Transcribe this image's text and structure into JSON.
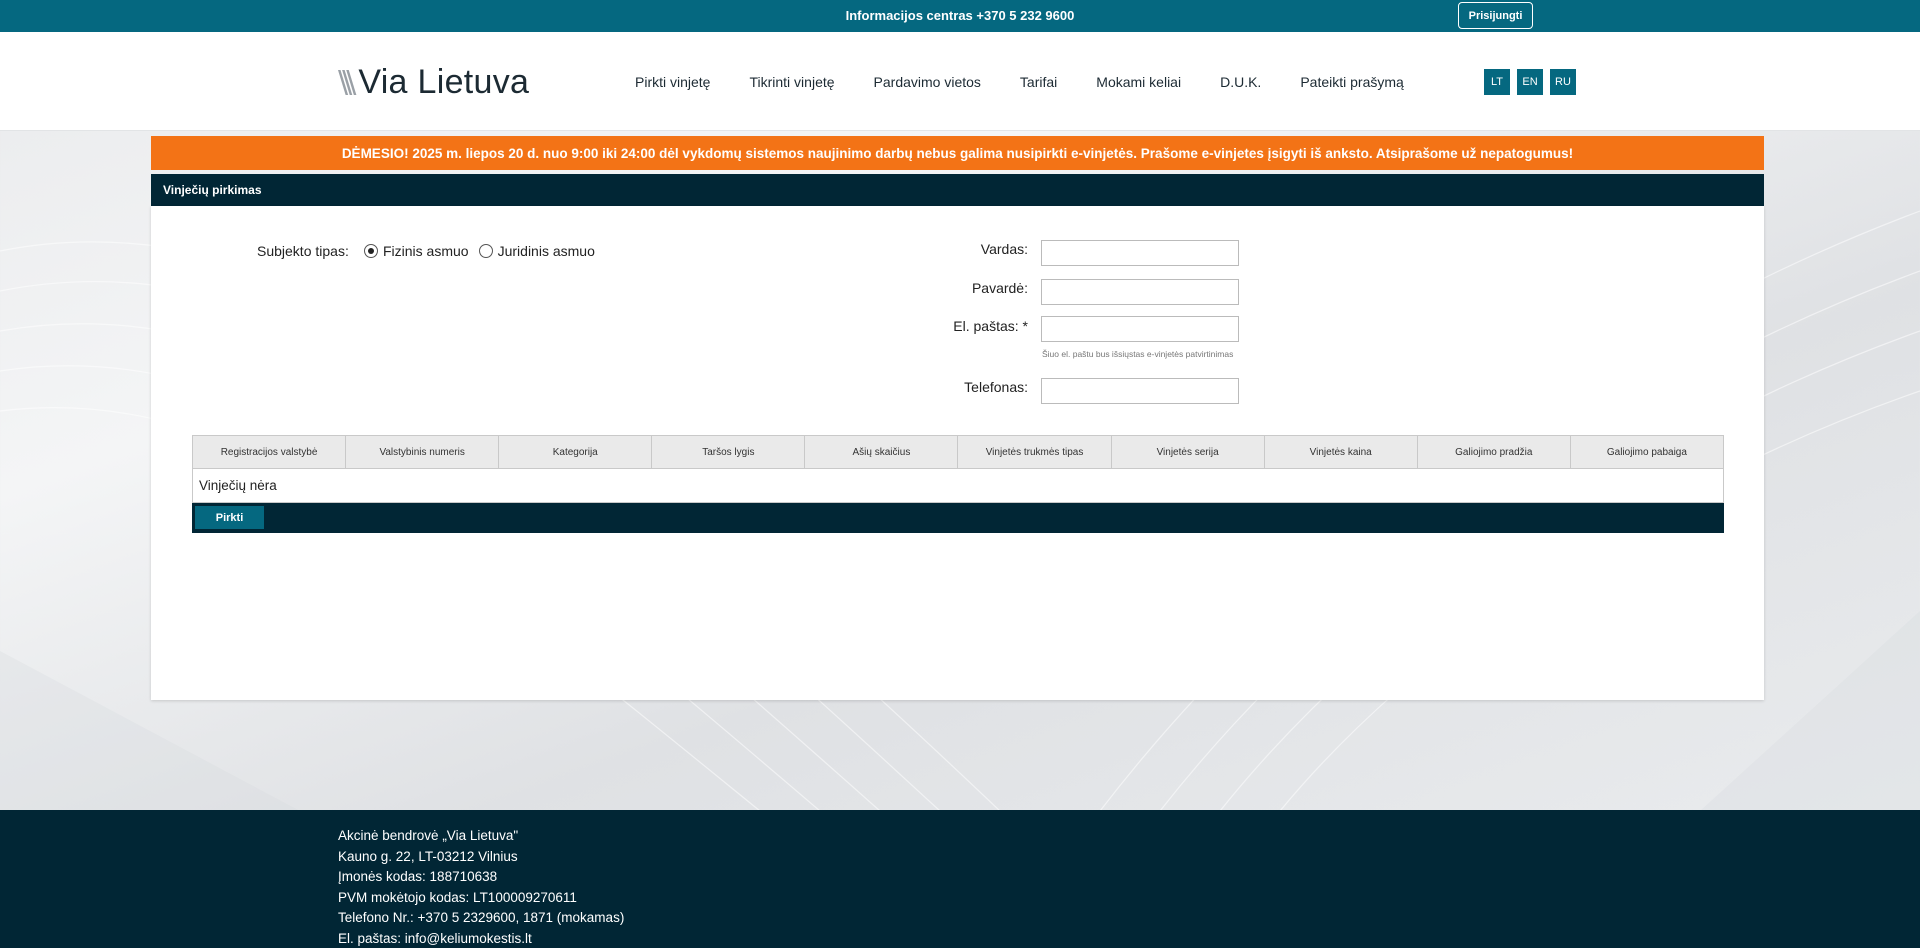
{
  "topbar": {
    "info": "Informacijos centras +370 5 232 9600",
    "login_label": "Prisijungti"
  },
  "header": {
    "logo_slashes": "\\\\\\",
    "logo_text": "Via Lietuva",
    "nav": [
      "Pirkti vinjetę",
      "Tikrinti vinjetę",
      "Pardavimo vietos",
      "Tarifai",
      "Mokami keliai",
      "D.U.K.",
      "Pateikti prašymą"
    ],
    "languages": [
      "LT",
      "EN",
      "RU"
    ]
  },
  "alert": {
    "text": "DĖMESIO! 2025 m. liepos 20 d. nuo 9:00 iki 24:00 dėl vykdomų sistemos naujinimo darbų nebus galima nusipirkti e-vinjetės. Prašome e-vinjetes įsigyti iš anksto. Atsiprašome už nepatogumus!",
    "color": "#f37316"
  },
  "panel": {
    "title": "Vinječių pirkimas",
    "subject_label": "Subjekto tipas:",
    "subject_options": [
      {
        "label": "Fizinis asmuo",
        "checked": true
      },
      {
        "label": "Juridinis asmuo",
        "checked": false
      }
    ],
    "fields": {
      "vardas": {
        "label": "Vardas:",
        "value": ""
      },
      "pavarde": {
        "label": "Pavardė:",
        "value": ""
      },
      "email": {
        "label": "El. paštas: *",
        "value": "",
        "hint": "Šiuo el. paštu bus išsiųstas e-vinjetės patvirtinimas"
      },
      "telefonas": {
        "label": "Telefonas:",
        "value": ""
      }
    },
    "table": {
      "columns": [
        "Registracijos valstybė",
        "Valstybinis numeris",
        "Kategorija",
        "Taršos lygis",
        "Ašių skaičius",
        "Vinjetės trukmės tipas",
        "Vinjetės serija",
        "Vinjetės kaina",
        "Galiojimo pradžia",
        "Galiojimo pabaiga"
      ],
      "empty_text": "Vinječių nėra"
    },
    "buy_label": "Pirkti"
  },
  "footer": {
    "lines": [
      "Akcinė bendrovė „Via Lietuva\"",
      "Kauno g. 22, LT-03212 Vilnius",
      "Įmonės kodas: 188710638",
      "PVM mokėtojo kodas: LT100009270611",
      "Telefono Nr.: +370 5 2329600, 1871 (mokamas)",
      "El. paštas: info@keliumokestis.lt"
    ]
  },
  "colors": {
    "primary": "#056880",
    "dark": "#012635",
    "accent": "#f37316"
  }
}
